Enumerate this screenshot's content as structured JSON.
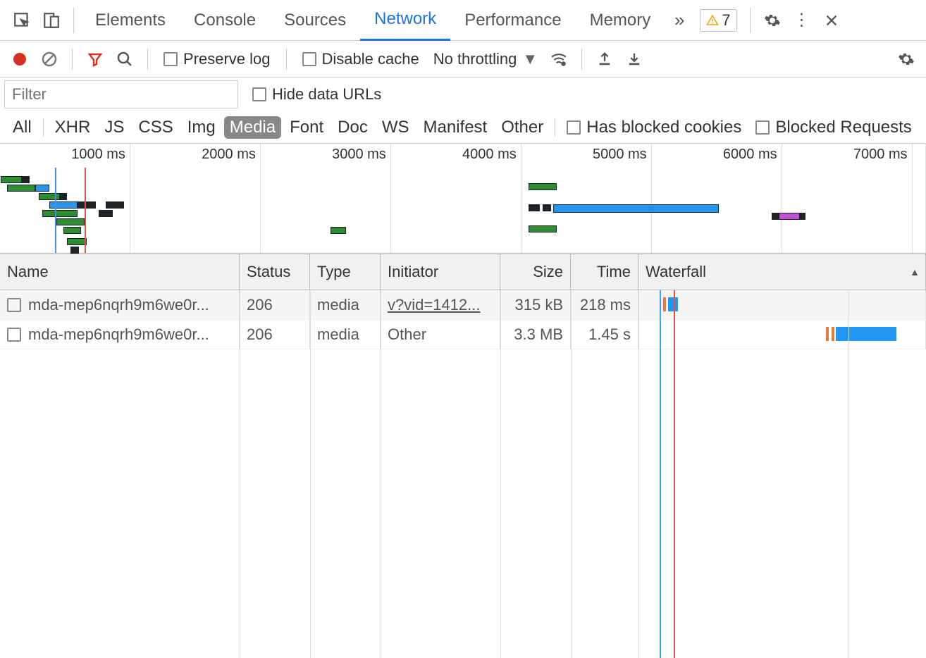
{
  "tabs": {
    "elements": "Elements",
    "console": "Console",
    "sources": "Sources",
    "network": "Network",
    "performance": "Performance",
    "memory": "Memory"
  },
  "warning_count": "7",
  "toolbar": {
    "preserve_log": "Preserve log",
    "disable_cache": "Disable cache",
    "throttling": "No throttling"
  },
  "filter": {
    "placeholder": "Filter",
    "hide_data_urls": "Hide data URLs"
  },
  "type_filters": {
    "all": "All",
    "xhr": "XHR",
    "js": "JS",
    "css": "CSS",
    "img": "Img",
    "media": "Media",
    "font": "Font",
    "doc": "Doc",
    "ws": "WS",
    "manifest": "Manifest",
    "other": "Other",
    "has_blocked": "Has blocked cookies",
    "blocked_requests": "Blocked Requests"
  },
  "timeline": {
    "ticks": [
      "1000 ms",
      "2000 ms",
      "3000 ms",
      "4000 ms",
      "5000 ms",
      "6000 ms",
      "7000 ms"
    ]
  },
  "columns": {
    "name": "Name",
    "status": "Status",
    "type": "Type",
    "initiator": "Initiator",
    "size": "Size",
    "time": "Time",
    "waterfall": "Waterfall"
  },
  "rows": [
    {
      "name": "mda-mep6nqrh9m6we0r...",
      "status": "206",
      "type": "media",
      "initiator": "v?vid=1412...",
      "initiator_link": true,
      "size": "315 kB",
      "time": "218 ms"
    },
    {
      "name": "mda-mep6nqrh9m6we0r...",
      "status": "206",
      "type": "media",
      "initiator": "Other",
      "initiator_link": false,
      "size": "3.3 MB",
      "time": "1.45 s"
    }
  ]
}
